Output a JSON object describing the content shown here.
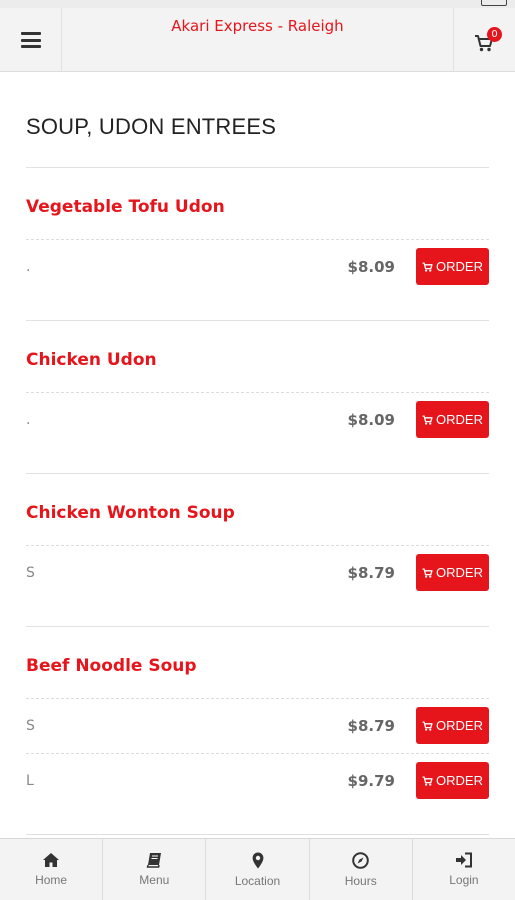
{
  "header": {
    "title": "Akari Express - Raleigh",
    "cart_count": "0"
  },
  "section": {
    "title": "SOUP, UDON ENTREES"
  },
  "order_label": "ORDER",
  "items": [
    {
      "name": "Vegetable Tofu Udon",
      "variants": [
        {
          "label": ".",
          "price": "$8.09"
        }
      ]
    },
    {
      "name": "Chicken Udon",
      "variants": [
        {
          "label": ".",
          "price": "$8.09"
        }
      ]
    },
    {
      "name": "Chicken Wonton Soup",
      "variants": [
        {
          "label": "S",
          "price": "$8.79"
        }
      ]
    },
    {
      "name": "Beef Noodle Soup",
      "variants": [
        {
          "label": "S",
          "price": "$8.79"
        },
        {
          "label": "L",
          "price": "$9.79"
        }
      ]
    }
  ],
  "nav": [
    {
      "label": "Home",
      "icon": "home-icon"
    },
    {
      "label": "Menu",
      "icon": "book-icon"
    },
    {
      "label": "Location",
      "icon": "map-marker-icon"
    },
    {
      "label": "Hours",
      "icon": "compass-icon"
    },
    {
      "label": "Login",
      "icon": "sign-in-icon"
    }
  ],
  "colors": {
    "accent": "#e6151b",
    "header_bg": "#f3f3f3"
  }
}
